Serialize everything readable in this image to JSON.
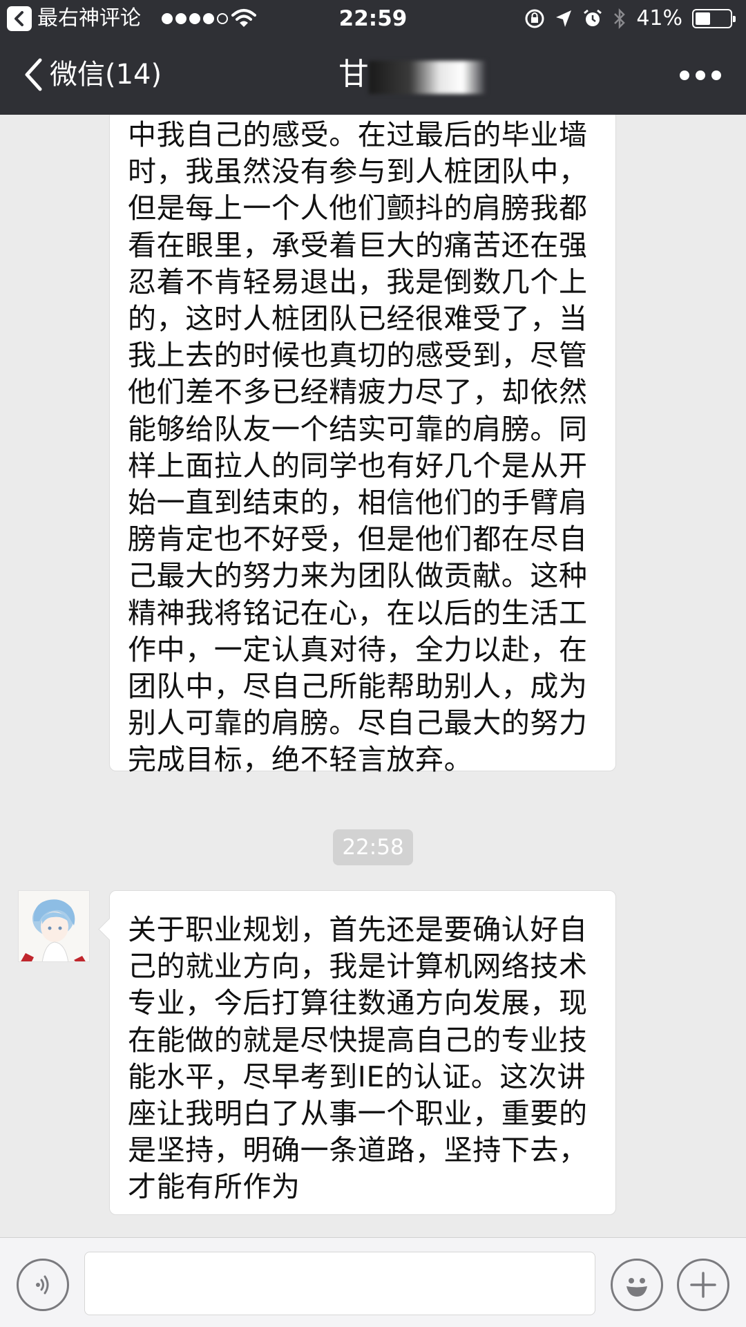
{
  "status_bar": {
    "back_app_label": "最右神评论",
    "time": "22:59",
    "battery_percent": "41%",
    "battery_level": 0.41,
    "signal_bars_filled": 4,
    "signal_bars_total": 5
  },
  "nav": {
    "back_label": "微信(14)",
    "title_visible": "甘"
  },
  "messages": [
    {
      "id": "msg-1",
      "lines": [
        "中我自己的感受。在过最后的毕业墙",
        "时，我虽然没有参与到人桩团队中，",
        "但是每上一个人他们颤抖的肩膀我都",
        "看在眼里，承受着巨大的痛苦还在强",
        "忍着不肯轻易退出，我是倒数几个上",
        "的，这时人桩团队已经很难受了，当",
        "我上去的时候也真切的感受到，尽管",
        "他们差不多已经精疲力尽了，却依然",
        "能够给队友一个结实可靠的肩膀。同",
        "样上面拉人的同学也有好几个是从开",
        "始一直到结束的，相信他们的手臂肩",
        "膀肯定也不好受，但是他们都在尽自",
        "己最大的努力来为团队做贡献。这种",
        "精神我将铭记在心，在以后的生活工",
        "作中，一定认真对待，全力以赴，在",
        "团队中，尽自己所能帮助别人，成为",
        "别人可靠的肩膀。尽自己最大的努力",
        "完成目标，绝不轻言放弃。"
      ]
    },
    {
      "id": "msg-2",
      "lines": [
        "关于职业规划，首先还是要确认好自",
        "己的就业方向，我是计算机网络技术",
        "专业，今后打算往数通方向发展，现",
        "在能做的就是尽快提高自己的专业技",
        "能水平，尽早考到IE的认证。这次讲",
        "座让我明白了从事一个职业，重要的",
        "是坚持，明确一条道路，坚持下去，",
        "才能有所作为"
      ]
    }
  ],
  "time_separator": "22:58",
  "icons": {
    "back": "chevron-left-icon",
    "more": "more-dots-icon",
    "voice": "voice-icon",
    "emoji": "emoji-icon",
    "plus": "plus-icon"
  },
  "colors": {
    "header_bg": "#2f3035",
    "chat_bg": "#ebebeb",
    "bubble_bg": "#ffffff",
    "time_sep_bg": "#d2d2d2",
    "input_bar_bg": "#f4f4f6"
  }
}
